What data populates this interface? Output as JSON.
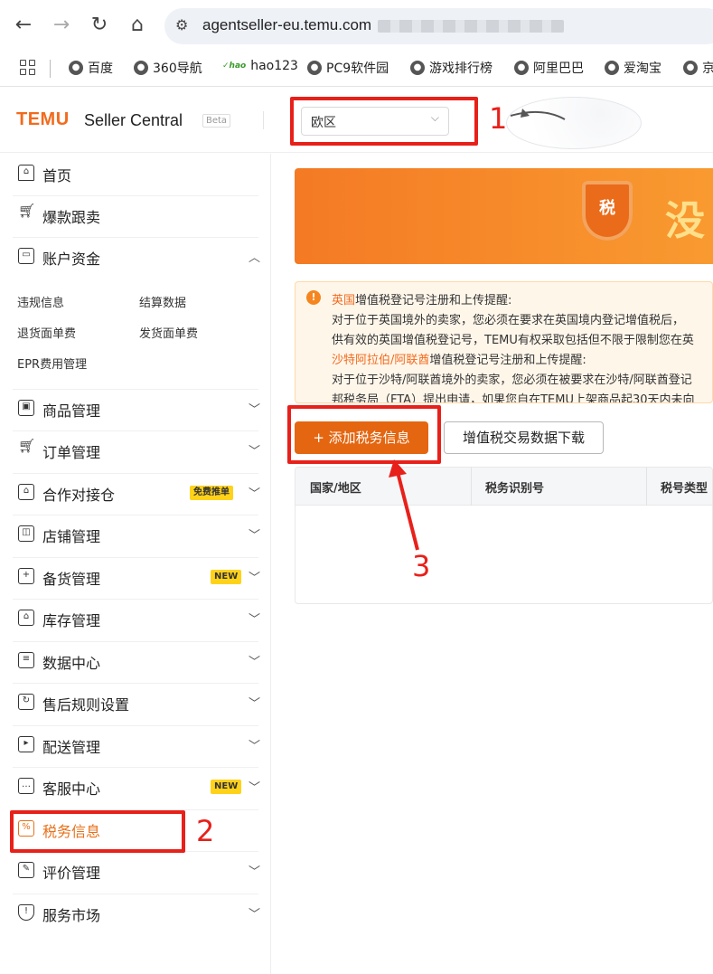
{
  "browser": {
    "url": "agentseller-eu.temu.com",
    "bookmarks": [
      "百度",
      "360导航",
      "hao123",
      "PC9软件园",
      "游戏排行榜",
      "阿里巴巴",
      "爱淘宝",
      "京"
    ]
  },
  "header": {
    "logo": "TEMU",
    "logo_sub": "Seller Central",
    "beta": "Beta",
    "region": "欧区"
  },
  "sidebar": {
    "items": [
      {
        "label": "首页",
        "icon": "home-icon"
      },
      {
        "label": "爆款跟卖",
        "icon": "cart-icon"
      },
      {
        "label": "账户资金",
        "icon": "wallet-icon"
      },
      {
        "label": "商品管理",
        "icon": "product-icon"
      },
      {
        "label": "订单管理",
        "icon": "order-icon"
      },
      {
        "label": "合作对接仓",
        "icon": "warehouse-icon",
        "tag": "免费推单"
      },
      {
        "label": "店铺管理",
        "icon": "store-icon"
      },
      {
        "label": "备货管理",
        "icon": "stock-icon",
        "tag": "NEW"
      },
      {
        "label": "库存管理",
        "icon": "inventory-icon"
      },
      {
        "label": "数据中心",
        "icon": "data-icon"
      },
      {
        "label": "售后规则设置",
        "icon": "aftersale-icon"
      },
      {
        "label": "配送管理",
        "icon": "delivery-icon"
      },
      {
        "label": "客服中心",
        "icon": "service-icon",
        "tag": "NEW"
      },
      {
        "label": "税务信息",
        "icon": "tax-icon"
      },
      {
        "label": "评价管理",
        "icon": "review-icon"
      },
      {
        "label": "服务市场",
        "icon": "market-icon"
      }
    ],
    "account_sub": [
      "违规信息",
      "结算数据",
      "退货面单费",
      "发货面单费",
      "EPR费用管理"
    ]
  },
  "banner": {
    "shield": "税",
    "text": "没"
  },
  "notice": {
    "uk_title_hl": "英国",
    "uk_title": "增值税登记号注册和上传提醒:",
    "uk_line1": "对于位于英国境外的卖家，您必须在要求在英国境内登记增值税后，",
    "uk_line2": "供有效的英国增值税登记号，TEMU有权采取包括但不限于限制您在英",
    "sa_title_hl": "沙特阿拉伯/阿联酋",
    "sa_title": "增值税登记号注册和上传提醒:",
    "sa_line1": "对于位于沙特/阿联酋境外的卖家，您必须在被要求在沙特/阿联酋登记",
    "sa_line2": "邦税务局（FTA）提出申请，如果您自在TEMU上架商品起30天内未向"
  },
  "actions": {
    "add": "+ 添加税务信息",
    "download": "增值税交易数据下载"
  },
  "table": {
    "columns": [
      "国家/地区",
      "税务识别号",
      "税号类型"
    ]
  },
  "annotations": [
    "1",
    "2",
    "3"
  ],
  "colors": {
    "accent": "#e46611",
    "annotation": "#e8201a"
  }
}
